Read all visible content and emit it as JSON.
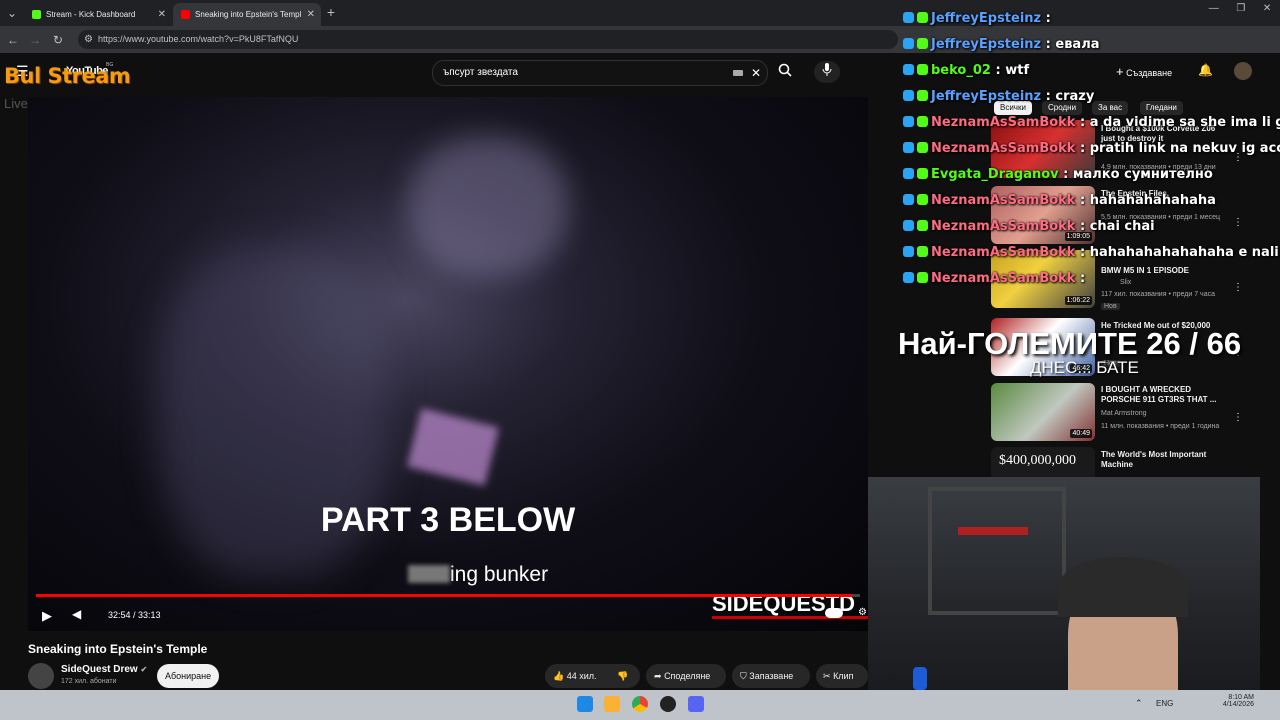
{
  "browser": {
    "tabs": [
      {
        "label": "Stream - Kick Dashboard",
        "close": "✕"
      },
      {
        "label": "Sneaking into Epstein's Temple",
        "close": "✕"
      }
    ],
    "new_tab": "+",
    "url": "https://www.youtube.com/watch?v=PkU8FTafNQU",
    "window_controls": [
      "—",
      "❐",
      "✕"
    ]
  },
  "overlay_logo": {
    "brand": "Bul Stream",
    "region": "BG",
    "tagline": "Live Webcasting Services"
  },
  "youtube": {
    "logo": "YouTube",
    "search_value": "ъпсурт звездата",
    "create_label": "Създаване",
    "filter_chips": [
      "Всички",
      "Сродни",
      "За вас",
      "Гледани"
    ]
  },
  "player": {
    "overlay_text": "PART 3 BELOW",
    "caption_visible": "ing bunker",
    "watermark": "SIDEQUESTD",
    "time": "32:54 / 33:13",
    "progress_fraction": 0.99
  },
  "video_info": {
    "title": "Sneaking into Epstein's Temple",
    "channel": "SideQuest Drew",
    "subscribers": "172 хил. абонати",
    "subscribe_label": "Абониране",
    "likes": "44 хил.",
    "share": "Споделяне",
    "save": "Запазване",
    "clip": "Клип"
  },
  "sidebar_videos": [
    {
      "title": "I Bought a $100k Corvette Z06 just to destroy it",
      "meta": "4,9 млн. показвания • преди 13 дни",
      "duration": ""
    },
    {
      "title": "The Epstein Files.",
      "meta": "5,5 млн. показвания • преди 1 месец",
      "duration": "1:09:05"
    },
    {
      "title": "BMW M5 IN 1 EPISODE",
      "channel": "Slix",
      "meta": "117 хил. показвания • преди 7 часа",
      "badge": "Нов",
      "duration": "1:06:22"
    },
    {
      "title": "He Tricked Me out of $20,000",
      "meta": "",
      "badge": "Нов",
      "duration": "46:42"
    },
    {
      "title": "I BOUGHT A WRECKED PORSCHE 911 GT3RS THAT ...",
      "channel": "Mat Armstrong",
      "meta": "11 млн. показвания • преди 1 година",
      "duration": "40:49"
    },
    {
      "title": "The World's Most Important Machine",
      "thumb_text": "$400,000,000",
      "meta": "",
      "duration": ""
    }
  ],
  "chat": [
    {
      "user": "JeffreyEpsteinz",
      "sep": " : ",
      "message": "",
      "color": "#5aa0ff"
    },
    {
      "user": "JeffreyEpsteinz",
      "sep": " : ",
      "message": "евала",
      "color": "#5aa0ff"
    },
    {
      "user": "beko_02",
      "sep": " : ",
      "message": "wtf",
      "color": "#53fc18"
    },
    {
      "user": "JeffreyEpsteinz",
      "sep": " : ",
      "message": "crazy",
      "color": "#5aa0ff"
    },
    {
      "user": "NeznamAsSamBokk",
      "sep": " : ",
      "message": "a da vidime sa she ima li gifte",
      "color": "#ff6b81"
    },
    {
      "user": "NeznamAsSamBokk",
      "sep": " : ",
      "message": "pratih link na nekuv ig acc",
      "color": "#ff6b81"
    },
    {
      "user": "Evgata_Draganov",
      "sep": " : ",
      "message": "малко сумнително",
      "color": "#53fc18"
    },
    {
      "user": "NeznamAsSamBokk",
      "sep": " : ",
      "message": "hahahahahahaha",
      "color": "#ff6b81"
    },
    {
      "user": "NeznamAsSamBokk",
      "sep": " : ",
      "message": "chai chai",
      "color": "#ff6b81"
    },
    {
      "user": "NeznamAsSamBokk",
      "sep": " : ",
      "message": "hahahahahahahaha e nali ti p",
      "color": "#ff6b81"
    },
    {
      "user": "NeznamAsSamBokk",
      "sep": " : ",
      "message": "",
      "color": "#ff6b81"
    }
  ],
  "stream_overlay": {
    "headline": "Най-ГОЛЕМИТЕ 26 / 66",
    "subline": "ДНЕС... БАТЕ"
  },
  "taskbar": {
    "lang": "ENG",
    "time": "8:10 AM",
    "date": "4/14/2026"
  },
  "colors": {
    "youtube_red": "#ff0000",
    "kick_green": "#53fc18",
    "bg": "#0f0f0f"
  }
}
